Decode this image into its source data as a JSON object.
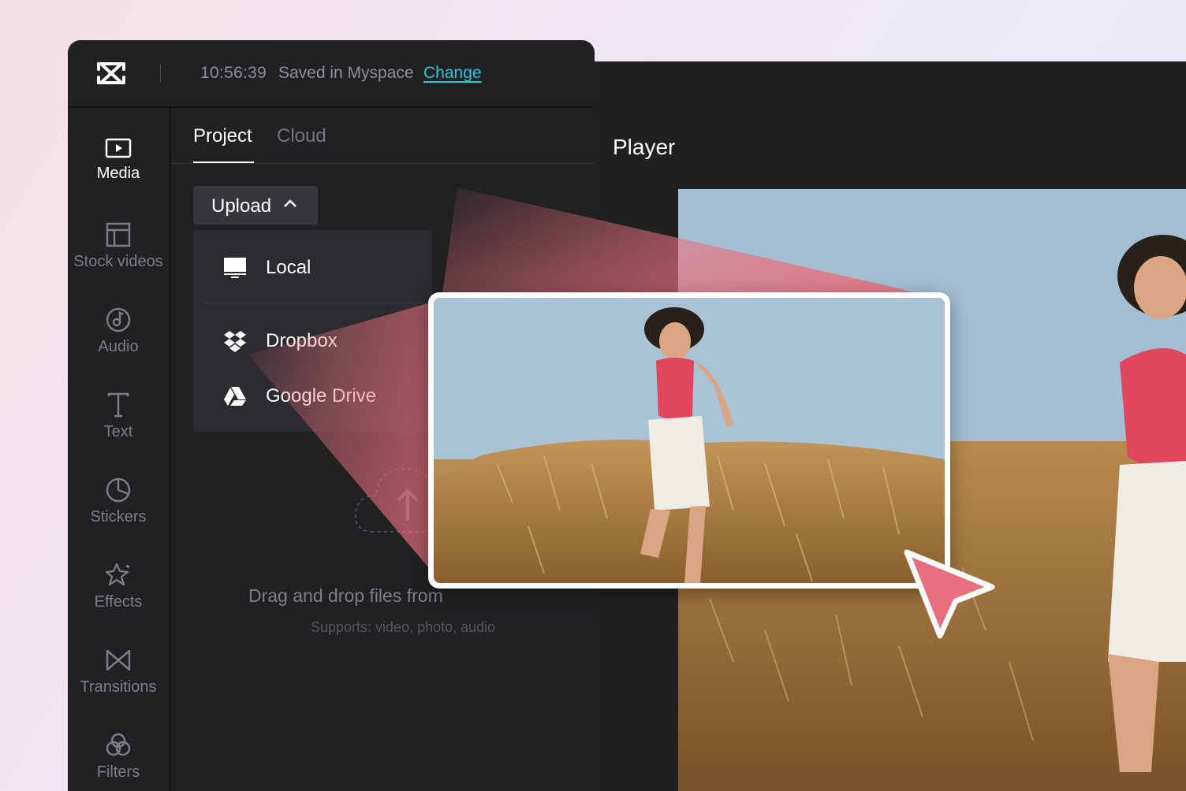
{
  "header": {
    "time": "10:56:39",
    "save_status": "Saved in Myspace",
    "change_link": "Change"
  },
  "sidebar": {
    "items": [
      {
        "label": "Media",
        "icon": "media-icon",
        "active": true
      },
      {
        "label": "Stock videos",
        "icon": "stock-videos-icon"
      },
      {
        "label": "Audio",
        "icon": "audio-icon"
      },
      {
        "label": "Text",
        "icon": "text-icon"
      },
      {
        "label": "Stickers",
        "icon": "stickers-icon"
      },
      {
        "label": "Effects",
        "icon": "effects-icon"
      },
      {
        "label": "Transitions",
        "icon": "transitions-icon"
      },
      {
        "label": "Filters",
        "icon": "filters-icon"
      }
    ]
  },
  "panel": {
    "tabs": [
      {
        "label": "Project",
        "active": true
      },
      {
        "label": "Cloud"
      }
    ],
    "upload_button": "Upload",
    "upload_menu": [
      {
        "label": "Local",
        "icon": "monitor-icon"
      },
      {
        "label": "Dropbox",
        "icon": "dropbox-icon"
      },
      {
        "label": "Google Drive",
        "icon": "google-drive-icon"
      }
    ],
    "drop_zone": {
      "title": "Drag and drop files from",
      "subtitle": "Supports: video, photo, audio"
    }
  },
  "player": {
    "title": "Player"
  },
  "colors": {
    "accent": "#2fc4d6",
    "highlight": "#e8707e",
    "panel_bg": "#212124"
  }
}
